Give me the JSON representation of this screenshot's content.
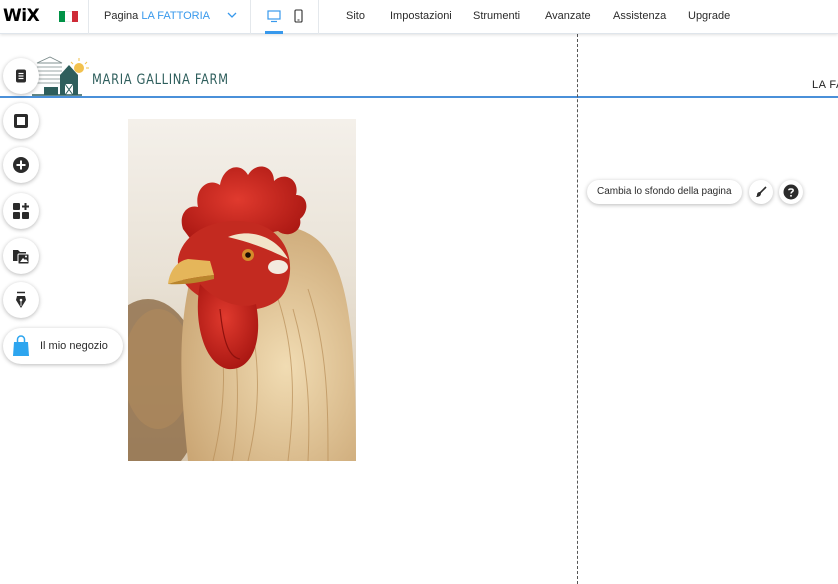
{
  "topbar": {
    "logo": "WiX",
    "flag_colors": [
      "#009246",
      "#ffffff",
      "#ce2b37"
    ],
    "page_prefix": "Pagina",
    "page_name": "LA FATTORIA",
    "menu": [
      "Sito",
      "Impostazioni",
      "Strumenti",
      "Avanzate",
      "Assistenza",
      "Upgrade"
    ]
  },
  "site": {
    "name": "MARIA GALLINA FARM",
    "nav_item": "LA FA"
  },
  "tools": {
    "store_label": "Il mio negozio"
  },
  "page_background": {
    "change_label": "Cambia lo sfondo della pagina"
  },
  "colors": {
    "accent": "#3899ec",
    "header_line": "#4a90d9",
    "brand_text": "#2e5e5c",
    "store_blue": "#2da5ef"
  }
}
